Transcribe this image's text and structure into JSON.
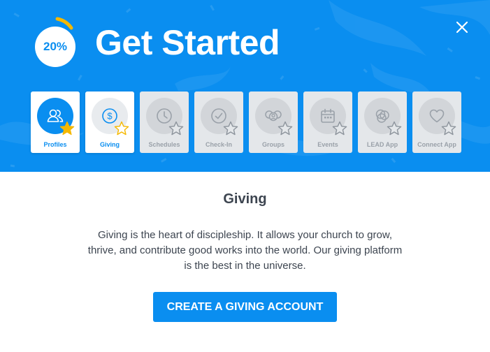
{
  "header": {
    "title": "Get Started",
    "progress_label": "20%",
    "progress_value": 0.2,
    "close_icon": "close-icon"
  },
  "steps": [
    {
      "label": "Profiles",
      "icon": "users-icon",
      "state": "completed"
    },
    {
      "label": "Giving",
      "icon": "dollar-icon",
      "state": "current"
    },
    {
      "label": "Schedules",
      "icon": "clock-icon",
      "state": "pending"
    },
    {
      "label": "Check-In",
      "icon": "check-circle-icon",
      "state": "pending"
    },
    {
      "label": "Groups",
      "icon": "groups-icon",
      "state": "pending"
    },
    {
      "label": "Events",
      "icon": "calendar-icon",
      "state": "pending"
    },
    {
      "label": "LEAD App",
      "icon": "lead-app-icon",
      "state": "pending"
    },
    {
      "label": "Connect App",
      "icon": "heart-icon",
      "state": "pending"
    }
  ],
  "content": {
    "title": "Giving",
    "description": "Giving is the heart of discipleship. It allows your church to grow, thrive, and contribute good works into the world. Our giving platform is the best in the universe.",
    "cta_label": "CREATE A GIVING ACCOUNT"
  },
  "colors": {
    "brand_blue": "#0a8ef0",
    "star_gold": "#f5b800",
    "text_dark": "#3d4550",
    "tile_inactive": "#e4e7ea"
  }
}
